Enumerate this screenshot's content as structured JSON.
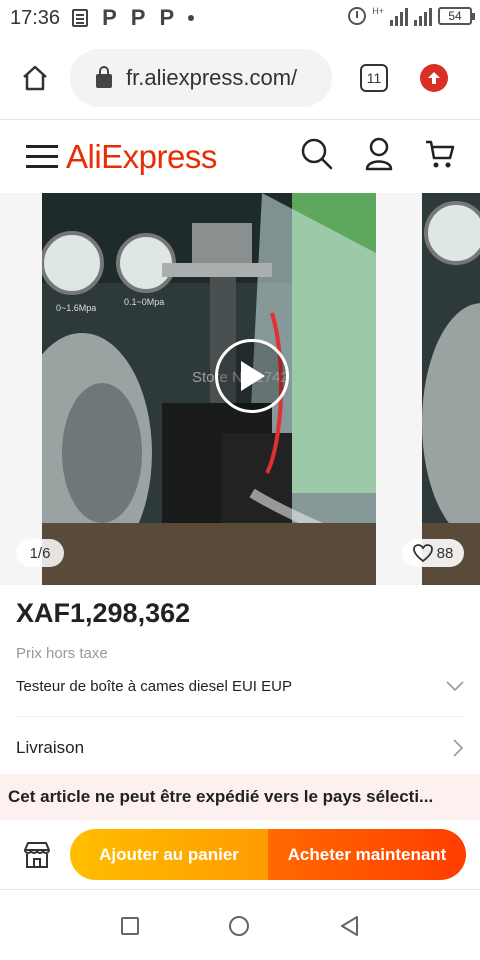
{
  "status_bar": {
    "time": "17:36",
    "left_icons": [
      "doc-icon",
      "p-icon",
      "p-icon",
      "p-icon",
      "dot-icon"
    ],
    "p_glyph": "P",
    "network_label": "H+",
    "battery": "54"
  },
  "browser": {
    "url": "fr.aliexpress.com/",
    "tab_count": "11"
  },
  "header": {
    "logo": "AliExpress",
    "icons": [
      "menu-icon",
      "search-icon",
      "account-icon",
      "cart-icon"
    ]
  },
  "gallery": {
    "counter": "1/6",
    "likes": "88",
    "watermark": "Store No.1742",
    "image_labels": [
      "0~1.6Mpa",
      "0.1~0Mpa"
    ]
  },
  "product": {
    "price": "XAF1,298,362",
    "tax_note": "Prix hors taxe",
    "title": "Testeur de boîte à cames diesel EUI EUP",
    "delivery_label": "Livraison",
    "warning": "Cet article ne peut être expédié vers le pays sélecti..."
  },
  "actions": {
    "add_to_cart": "Ajouter au panier",
    "buy_now": "Acheter maintenant"
  },
  "colors": {
    "brand": "#e62e04",
    "cart_button": "#ffa400",
    "buy_button": "#ff4f00",
    "warning_bg": "#fdf1ef"
  }
}
